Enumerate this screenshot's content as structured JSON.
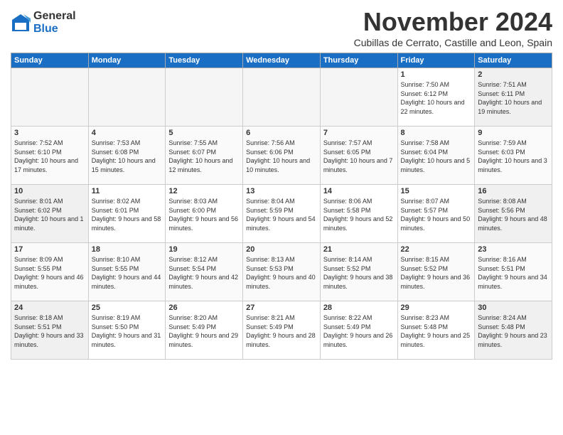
{
  "header": {
    "logo_line1": "General",
    "logo_line2": "Blue",
    "month_title": "November 2024",
    "subtitle": "Cubillas de Cerrato, Castille and Leon, Spain"
  },
  "days_of_week": [
    "Sunday",
    "Monday",
    "Tuesday",
    "Wednesday",
    "Thursday",
    "Friday",
    "Saturday"
  ],
  "weeks": [
    {
      "days": [
        {
          "num": "",
          "empty": true
        },
        {
          "num": "",
          "empty": true
        },
        {
          "num": "",
          "empty": true
        },
        {
          "num": "",
          "empty": true
        },
        {
          "num": "",
          "empty": true
        },
        {
          "num": "1",
          "sunrise": "Sunrise: 7:50 AM",
          "sunset": "Sunset: 6:12 PM",
          "daylight": "Daylight: 10 hours and 22 minutes."
        },
        {
          "num": "2",
          "sunrise": "Sunrise: 7:51 AM",
          "sunset": "Sunset: 6:11 PM",
          "daylight": "Daylight: 10 hours and 19 minutes."
        }
      ]
    },
    {
      "days": [
        {
          "num": "3",
          "sunrise": "Sunrise: 7:52 AM",
          "sunset": "Sunset: 6:10 PM",
          "daylight": "Daylight: 10 hours and 17 minutes."
        },
        {
          "num": "4",
          "sunrise": "Sunrise: 7:53 AM",
          "sunset": "Sunset: 6:08 PM",
          "daylight": "Daylight: 10 hours and 15 minutes."
        },
        {
          "num": "5",
          "sunrise": "Sunrise: 7:55 AM",
          "sunset": "Sunset: 6:07 PM",
          "daylight": "Daylight: 10 hours and 12 minutes."
        },
        {
          "num": "6",
          "sunrise": "Sunrise: 7:56 AM",
          "sunset": "Sunset: 6:06 PM",
          "daylight": "Daylight: 10 hours and 10 minutes."
        },
        {
          "num": "7",
          "sunrise": "Sunrise: 7:57 AM",
          "sunset": "Sunset: 6:05 PM",
          "daylight": "Daylight: 10 hours and 7 minutes."
        },
        {
          "num": "8",
          "sunrise": "Sunrise: 7:58 AM",
          "sunset": "Sunset: 6:04 PM",
          "daylight": "Daylight: 10 hours and 5 minutes."
        },
        {
          "num": "9",
          "sunrise": "Sunrise: 7:59 AM",
          "sunset": "Sunset: 6:03 PM",
          "daylight": "Daylight: 10 hours and 3 minutes."
        }
      ]
    },
    {
      "days": [
        {
          "num": "10",
          "sunrise": "Sunrise: 8:01 AM",
          "sunset": "Sunset: 6:02 PM",
          "daylight": "Daylight: 10 hours and 1 minute."
        },
        {
          "num": "11",
          "sunrise": "Sunrise: 8:02 AM",
          "sunset": "Sunset: 6:01 PM",
          "daylight": "Daylight: 9 hours and 58 minutes."
        },
        {
          "num": "12",
          "sunrise": "Sunrise: 8:03 AM",
          "sunset": "Sunset: 6:00 PM",
          "daylight": "Daylight: 9 hours and 56 minutes."
        },
        {
          "num": "13",
          "sunrise": "Sunrise: 8:04 AM",
          "sunset": "Sunset: 5:59 PM",
          "daylight": "Daylight: 9 hours and 54 minutes."
        },
        {
          "num": "14",
          "sunrise": "Sunrise: 8:06 AM",
          "sunset": "Sunset: 5:58 PM",
          "daylight": "Daylight: 9 hours and 52 minutes."
        },
        {
          "num": "15",
          "sunrise": "Sunrise: 8:07 AM",
          "sunset": "Sunset: 5:57 PM",
          "daylight": "Daylight: 9 hours and 50 minutes."
        },
        {
          "num": "16",
          "sunrise": "Sunrise: 8:08 AM",
          "sunset": "Sunset: 5:56 PM",
          "daylight": "Daylight: 9 hours and 48 minutes."
        }
      ]
    },
    {
      "days": [
        {
          "num": "17",
          "sunrise": "Sunrise: 8:09 AM",
          "sunset": "Sunset: 5:55 PM",
          "daylight": "Daylight: 9 hours and 46 minutes."
        },
        {
          "num": "18",
          "sunrise": "Sunrise: 8:10 AM",
          "sunset": "Sunset: 5:55 PM",
          "daylight": "Daylight: 9 hours and 44 minutes."
        },
        {
          "num": "19",
          "sunrise": "Sunrise: 8:12 AM",
          "sunset": "Sunset: 5:54 PM",
          "daylight": "Daylight: 9 hours and 42 minutes."
        },
        {
          "num": "20",
          "sunrise": "Sunrise: 8:13 AM",
          "sunset": "Sunset: 5:53 PM",
          "daylight": "Daylight: 9 hours and 40 minutes."
        },
        {
          "num": "21",
          "sunrise": "Sunrise: 8:14 AM",
          "sunset": "Sunset: 5:52 PM",
          "daylight": "Daylight: 9 hours and 38 minutes."
        },
        {
          "num": "22",
          "sunrise": "Sunrise: 8:15 AM",
          "sunset": "Sunset: 5:52 PM",
          "daylight": "Daylight: 9 hours and 36 minutes."
        },
        {
          "num": "23",
          "sunrise": "Sunrise: 8:16 AM",
          "sunset": "Sunset: 5:51 PM",
          "daylight": "Daylight: 9 hours and 34 minutes."
        }
      ]
    },
    {
      "days": [
        {
          "num": "24",
          "sunrise": "Sunrise: 8:18 AM",
          "sunset": "Sunset: 5:51 PM",
          "daylight": "Daylight: 9 hours and 33 minutes."
        },
        {
          "num": "25",
          "sunrise": "Sunrise: 8:19 AM",
          "sunset": "Sunset: 5:50 PM",
          "daylight": "Daylight: 9 hours and 31 minutes."
        },
        {
          "num": "26",
          "sunrise": "Sunrise: 8:20 AM",
          "sunset": "Sunset: 5:49 PM",
          "daylight": "Daylight: 9 hours and 29 minutes."
        },
        {
          "num": "27",
          "sunrise": "Sunrise: 8:21 AM",
          "sunset": "Sunset: 5:49 PM",
          "daylight": "Daylight: 9 hours and 28 minutes."
        },
        {
          "num": "28",
          "sunrise": "Sunrise: 8:22 AM",
          "sunset": "Sunset: 5:49 PM",
          "daylight": "Daylight: 9 hours and 26 minutes."
        },
        {
          "num": "29",
          "sunrise": "Sunrise: 8:23 AM",
          "sunset": "Sunset: 5:48 PM",
          "daylight": "Daylight: 9 hours and 25 minutes."
        },
        {
          "num": "30",
          "sunrise": "Sunrise: 8:24 AM",
          "sunset": "Sunset: 5:48 PM",
          "daylight": "Daylight: 9 hours and 23 minutes."
        }
      ]
    }
  ]
}
